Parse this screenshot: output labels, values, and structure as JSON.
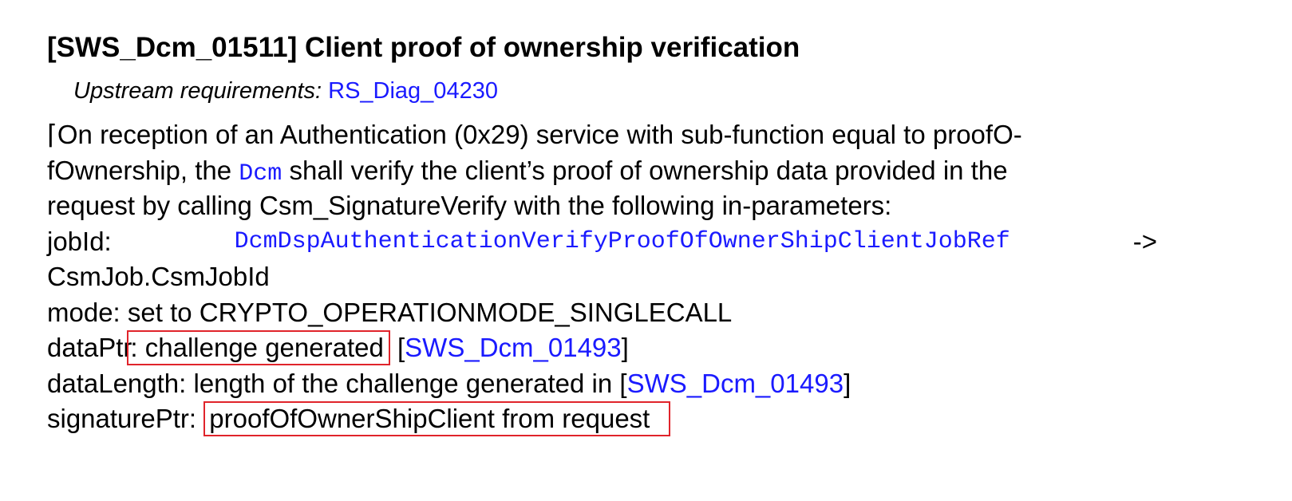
{
  "requirement": {
    "title": "[SWS_Dcm_01511] Client proof of ownership verification",
    "upstream_label": "Upstream requirements:",
    "upstream_link": "RS_Diag_04230"
  },
  "body": {
    "open_bracket": "⌈",
    "line1": "On reception of an Authentication (0x29) service with sub-function equal to proofO-",
    "line2_a": "fOwnership, the",
    "line2_module": "Dcm",
    "line2_b": "shall verify the client’s proof of ownership data provided in the",
    "line3": "request by calling Csm_SignatureVerify with the following in-parameters:",
    "jobid_label": "jobId:",
    "jobid_ref": "DcmDspAuthenticationVerifyProofOfOwnerShipClientJobRef",
    "jobid_arrow": "->",
    "jobid_target": "CsmJob.CsmJobId",
    "mode_line": "mode: set to CRYPTO_OPERATIONMODE_SINGLECALL",
    "dataptr_label": "dataPtr",
    "dataptr_value": ": challenge generated",
    "dataptr_ref_open": " [",
    "dataptr_ref": "SWS_Dcm_01493",
    "dataptr_ref_close": "]",
    "datalength_text": "dataLength: length of the challenge generated in [",
    "datalength_ref": "SWS_Dcm_01493",
    "datalength_close": "]",
    "sigptr_label": "signaturePtr: ",
    "sigptr_value": "proofOfOwnerShipClient from request"
  },
  "colors": {
    "link": "#1a1aff",
    "highlight_box": "#e0242b"
  }
}
